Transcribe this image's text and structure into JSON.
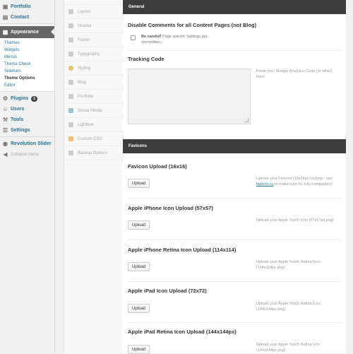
{
  "sidebar": {
    "portfolio": "Portfolio",
    "contact": "Contact",
    "appearance": "Appearance",
    "sub": [
      "Themes",
      "Widgets",
      "Menus",
      "Theme Check",
      "Sidebars",
      "Theme Options",
      "Editor"
    ],
    "plugins": "Plugins",
    "plugins_badge": "1",
    "users": "Users",
    "tools": "Tools",
    "settings": "Settings",
    "revslider": "Revolution Slider",
    "collapse": "Collapse menu"
  },
  "tabs": [
    "Layout",
    "Header",
    "Footer",
    "Typography",
    "Styling",
    "Blog",
    "Portfolio",
    "Social Media",
    "Lightbox",
    "Custom CSS",
    "Backup Options"
  ],
  "general": {
    "heading": "General",
    "disable_title": "Disable Comments for all Content Pages (not Blog)",
    "disable_help_bold": "Be careful!",
    "disable_help_rest": "Page specific Settings get overwritten.",
    "tracking_title": "Tracking Code",
    "tracking_desc": "Paste your Google Analytics Code (or other) here."
  },
  "favicons": {
    "heading": "Favicons",
    "upload_label": "Upload",
    "items": [
      {
        "title": "Favicon Upload (16x16)",
        "desc_a": "Upload your Favicon (16x16px ico/png - use ",
        "desc_link": "favicon.cc",
        "desc_b": " to make sure it's fully compatible)"
      },
      {
        "title": "Apple iPhone Icon Upload (57x57)",
        "desc": "Upload your Apple Touch Icon (57x57px png)"
      },
      {
        "title": "Apple iPhone Retina Icon Upload (114x114)",
        "desc": "Upload your Apple Touch Retina Icon (114x114px png)"
      },
      {
        "title": "Apple iPad Icon Upload (72x72)",
        "desc": "Upload your Apple Touch Retina Icon (144x144px png)"
      },
      {
        "title": "Apple iPad Retina Icon Upload (144x144px)",
        "desc": "Upload your Apple Touch Retina Icon (144x144px png)"
      }
    ]
  }
}
